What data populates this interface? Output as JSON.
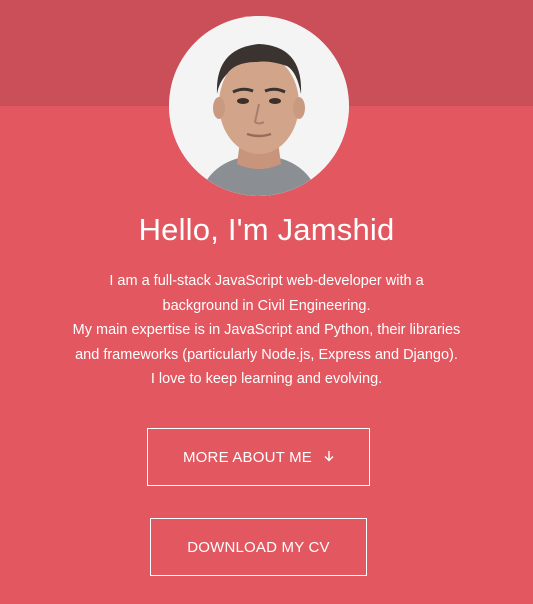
{
  "hero": {
    "title": "Hello, I'm Jamshid",
    "bio_lines": [
      "I am a full-stack JavaScript web-developer with a",
      "background in Civil Engineering.",
      "My main expertise is in JavaScript and Python, their libraries",
      "and frameworks (particularly Node.js, Express and Django).",
      "I love to keep learning and evolving."
    ]
  },
  "buttons": {
    "more_label": "MORE ABOUT ME",
    "more_icon": "arrow-down-icon",
    "cv_label": "DOWNLOAD MY CV"
  },
  "colors": {
    "background": "#e35760",
    "top_band": "#cb4f58",
    "text": "#ffffff"
  }
}
